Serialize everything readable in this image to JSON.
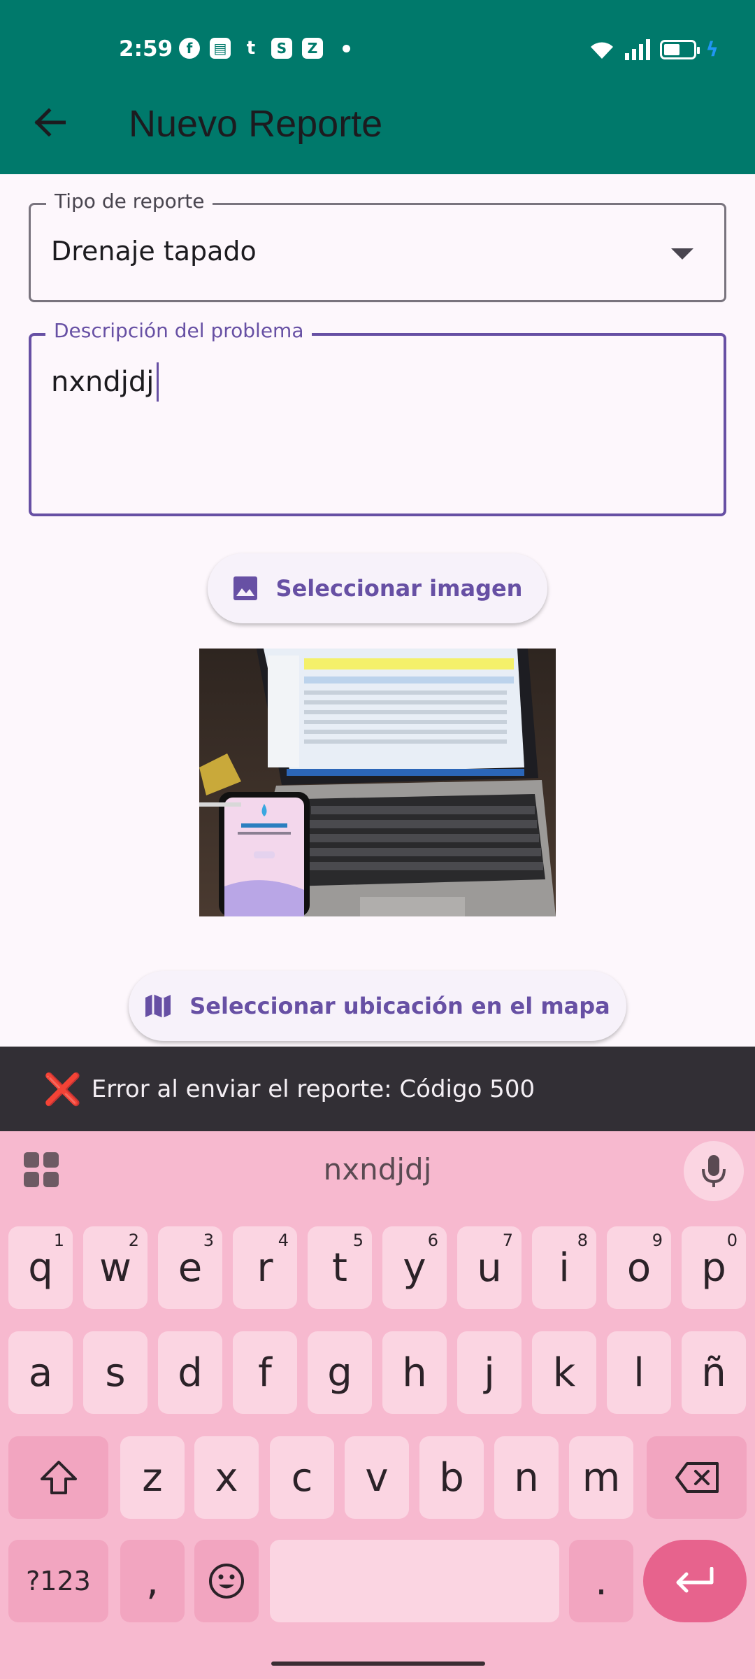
{
  "status_bar": {
    "time": "2:59",
    "notification_icons": [
      "facebook-icon",
      "contact-card-icon",
      "tumblr-icon",
      "skype-icon",
      "zulip-icon"
    ]
  },
  "app_bar": {
    "title": "Nuevo Reporte",
    "background": "#00796b"
  },
  "form": {
    "report_type": {
      "label": "Tipo de reporte",
      "value": "Drenaje tapado"
    },
    "description": {
      "label": "Descripción del problema",
      "value": "nxndjdj"
    },
    "select_image_label": "Seleccionar imagen",
    "select_location_label": "Seleccionar ubicación en el mapa"
  },
  "snackbar": {
    "icon": "❌",
    "text": "Error al enviar el reporte: Código 500"
  },
  "keyboard": {
    "suggestion": "nxndjdj",
    "row1": [
      {
        "key": "q",
        "hint": "1"
      },
      {
        "key": "w",
        "hint": "2"
      },
      {
        "key": "e",
        "hint": "3"
      },
      {
        "key": "r",
        "hint": "4"
      },
      {
        "key": "t",
        "hint": "5"
      },
      {
        "key": "y",
        "hint": "6"
      },
      {
        "key": "u",
        "hint": "7"
      },
      {
        "key": "i",
        "hint": "8"
      },
      {
        "key": "o",
        "hint": "9"
      },
      {
        "key": "p",
        "hint": "0"
      }
    ],
    "row2": [
      "a",
      "s",
      "d",
      "f",
      "g",
      "h",
      "j",
      "k",
      "l",
      "ñ"
    ],
    "row3": [
      "z",
      "x",
      "c",
      "v",
      "b",
      "n",
      "m"
    ],
    "symbols_label": "?123",
    "comma_label": ",",
    "period_label": "."
  },
  "colors": {
    "primary": "#6750a4",
    "keyboard_bg": "#f7b9cf",
    "enter_key": "#e7638d"
  }
}
